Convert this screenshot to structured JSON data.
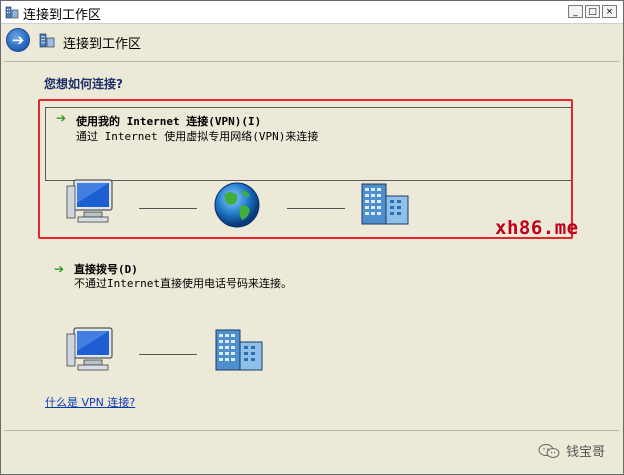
{
  "window": {
    "title": "连接到工作区",
    "controls": {
      "minimize": "_",
      "maximize": "□",
      "close": "×"
    }
  },
  "nav": {
    "back_icon": "back-arrow-icon",
    "title": "连接到工作区"
  },
  "main": {
    "question": "您想如何连接?",
    "options": [
      {
        "arrow": "➔",
        "title": "使用我的 Internet 连接(VPN)(I)",
        "description": "通过 Internet 使用虚拟专用网络(VPN)来连接",
        "diagram": [
          "computer-icon",
          "globe-icon",
          "building-icon"
        ]
      },
      {
        "arrow": "➔",
        "title": "直接拨号(D)",
        "description": "不通过Internet直接使用电话号码来连接。",
        "diagram": [
          "computer-icon",
          "building-icon"
        ]
      }
    ],
    "help_link": "什么是 VPN 连接?"
  },
  "overlay": {
    "watermark": "xh86.me",
    "footer_text": "钱宝哥",
    "highlight_color": "#e4262a"
  }
}
